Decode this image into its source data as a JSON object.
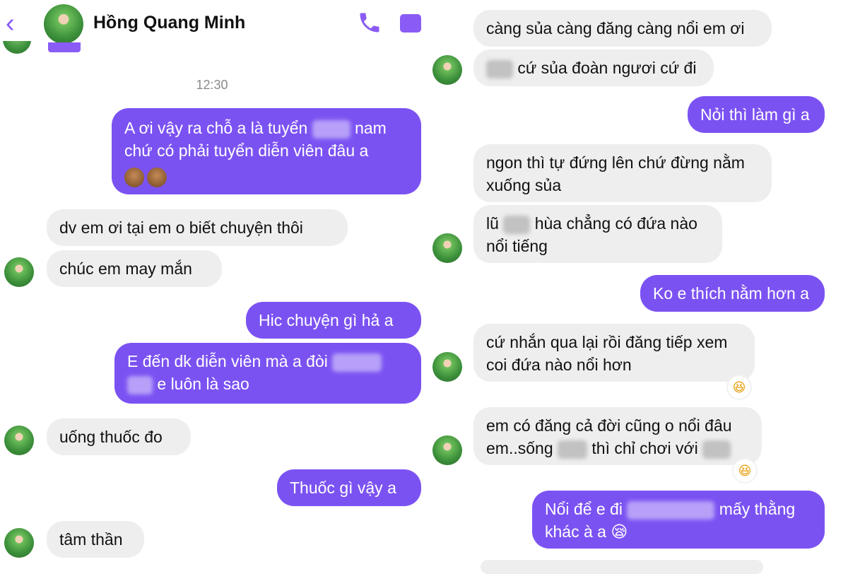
{
  "header": {
    "back_icon": "chevron-left-icon",
    "contact_name": "Hồng Quang Minh",
    "call_icon": "phone-icon",
    "video_icon": "video-icon"
  },
  "colors": {
    "accent": "#7b52f2",
    "incoming_bubble": "#eeeeee"
  },
  "left_panel": {
    "timestamp": "12:30",
    "messages": [
      {
        "direction": "out",
        "line1a": "A ơi vậy ra chỗ a là tuyển",
        "line1b": "nam",
        "line2": "chứ có phải tuyển diễn viên đâu a"
      },
      {
        "direction": "in",
        "text": "dv em ơi tại em o biết chuyện thôi"
      },
      {
        "direction": "in",
        "text": "chúc em may mắn"
      },
      {
        "direction": "out",
        "text": "Hic chuyện gì hả a"
      },
      {
        "direction": "out",
        "line1": "E đến dk diễn viên mà a đòi",
        "line2": "e luôn là sao"
      },
      {
        "direction": "in",
        "text": "uống thuốc đo"
      },
      {
        "direction": "out",
        "text": "Thuốc gì vậy a"
      },
      {
        "direction": "in",
        "text": "tâm thần"
      }
    ]
  },
  "right_panel": {
    "messages": [
      {
        "direction": "in",
        "text": "càng sủa càng đăng càng nổi em ơi"
      },
      {
        "direction": "in",
        "text": "cứ sủa đoàn ngươi cứ đi"
      },
      {
        "direction": "out",
        "text": "Nỏi thì làm gì a"
      },
      {
        "direction": "in",
        "line1": "ngon thì tự đứng lên chứ đừng nằm",
        "line2": "xuống sủa"
      },
      {
        "direction": "in",
        "line1a": "lũ",
        "line1b": "hùa chẳng có đứa nào",
        "line2": "nổi tiếng"
      },
      {
        "direction": "out",
        "text": "Ko e thích nằm hơn a"
      },
      {
        "direction": "in",
        "line1": "cứ nhắn qua lại rồi đăng tiếp xem",
        "line2": "coi đứa nào nổi hơn",
        "reaction": "😆"
      },
      {
        "direction": "in",
        "line1": "em có đăng cả đời cũng o nổi đâu",
        "line2a": "em..sống",
        "line2b": "thì chỉ chơi với",
        "reaction": "😆"
      },
      {
        "direction": "out",
        "line1a": "Nổi để e đi",
        "line1b": "mấy thằng",
        "line2": "khác à a",
        "emoji": "😪"
      }
    ]
  }
}
